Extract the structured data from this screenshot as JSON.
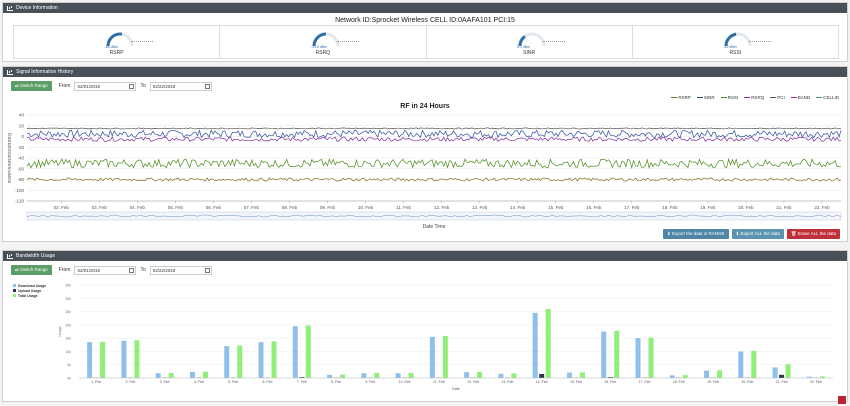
{
  "device_panel": {
    "title": "Device Information",
    "network_line": "Network ID:Sprocket Wireless  CELL ID:0AAFA101  PCI:15",
    "gauges": [
      {
        "label": "RSRP",
        "value": "-85 dBm",
        "level": 0.55
      },
      {
        "label": "RSRQ",
        "value": "-13.0 dBm",
        "level": 0.5
      },
      {
        "label": "SINR",
        "value": "6.1 dBm",
        "level": 0.3
      },
      {
        "label": "RSSI",
        "value": "-52 dBm",
        "level": 0.45
      }
    ]
  },
  "signal_panel": {
    "title": "Signal Information History",
    "switch_label": "⇄ Switch Range",
    "from_label": "From",
    "from_value": "02/01/2018",
    "to_label": "To",
    "to_value": "02/22/2018",
    "export_range": "Export the data in RANGE",
    "export_all": "Export ALL the data",
    "erase_all": "Erase ALL the data"
  },
  "bandwidth_panel": {
    "title": "Bandwidth Usage",
    "switch_label": "⇄ Switch Range",
    "from_label": "From",
    "from_value": "02/01/2018",
    "to_label": "To",
    "to_value": "02/22/2018"
  },
  "colors": {
    "rsrp": "#8a6d1e",
    "sinr": "#2d4f9a",
    "rssi": "#4a8a1a",
    "rsrq": "#7a2a9a",
    "pci": "#555555",
    "band": "#a02aa0",
    "cellid": "#2a9a9a",
    "download": "#8fc0ec",
    "upload": "#2a3550",
    "total": "#90ee7a",
    "btn_blue": "#4f86a6",
    "btn_blue2": "#5c93b0",
    "btn_red": "#c0303a"
  },
  "chart_data": [
    {
      "type": "line",
      "title": "RF in 24 Hours",
      "xlabel": "Date Time",
      "ylabel": "RSRP/SINR/RSSI/RSRQ",
      "ylim": [
        -120,
        40
      ],
      "yticks": [
        "40",
        "20",
        "0",
        "-20",
        "-40",
        "-60",
        "-80",
        "-100",
        "-120"
      ],
      "x_ticks": [
        "02. Feb",
        "03. Feb",
        "04. Feb",
        "05. Feb",
        "06. Feb",
        "07. Feb",
        "08. Feb",
        "09. Feb",
        "10. Feb",
        "11. Feb",
        "12. Feb",
        "13. Feb",
        "14. Feb",
        "15. Feb",
        "16. Feb",
        "17. Feb",
        "18. Feb",
        "19. Feb",
        "20. Feb",
        "21. Feb",
        "22. Feb"
      ],
      "legend": [
        "RSRP",
        "SINR",
        "RSSI",
        "RSRQ",
        "PCI",
        "BAND",
        "CELLID"
      ],
      "series": [
        {
          "name": "SINR",
          "level": 5
        },
        {
          "name": "RSRQ",
          "level": -5
        },
        {
          "name": "RSSI",
          "level": -50
        },
        {
          "name": "RSRP",
          "level": -80
        },
        {
          "name": "PCI",
          "level": 15
        }
      ]
    },
    {
      "type": "bar",
      "xlabel": "Date",
      "ylabel": "Usage",
      "ylim": [
        0,
        35
      ],
      "yticks": [
        "35",
        "30",
        "25",
        "20",
        "15",
        "10",
        "5",
        "0"
      ],
      "yunit": "k",
      "categories": [
        "1. Feb",
        "2. Feb",
        "3. Feb",
        "4. Feb",
        "5. Feb",
        "6. Feb",
        "7. Feb",
        "8. Feb",
        "9. Feb",
        "10. Feb",
        "11. Feb",
        "12. Feb",
        "13. Feb",
        "14. Feb",
        "15. Feb",
        "16. Feb",
        "17. Feb",
        "18. Feb",
        "19. Feb",
        "20. Feb",
        "21. Feb",
        "22. Feb"
      ],
      "series": [
        {
          "name": "Download Usage",
          "values": [
            13.5,
            14,
            1.8,
            2.3,
            12,
            13.5,
            19.5,
            1.2,
            1.8,
            1.8,
            15.5,
            2.2,
            1.6,
            24.5,
            2,
            17.5,
            15,
            1,
            2.8,
            10,
            4,
            0.5
          ]
        },
        {
          "name": "Upload Usage",
          "values": [
            0.1,
            0.1,
            0.1,
            0.1,
            0.1,
            0.1,
            0.3,
            0.1,
            0.1,
            0.1,
            0.1,
            0.1,
            0.1,
            1.5,
            0.1,
            0.3,
            0.1,
            0.1,
            0.1,
            0.1,
            1.2,
            0.1
          ]
        },
        {
          "name": "Total Usage",
          "values": [
            13.6,
            14.2,
            1.9,
            2.4,
            12.2,
            13.8,
            19.8,
            1.3,
            1.9,
            1.9,
            15.8,
            2.3,
            1.7,
            26,
            2.1,
            17.8,
            15.2,
            1.1,
            2.9,
            10.2,
            5.2,
            0.6
          ]
        }
      ]
    }
  ]
}
